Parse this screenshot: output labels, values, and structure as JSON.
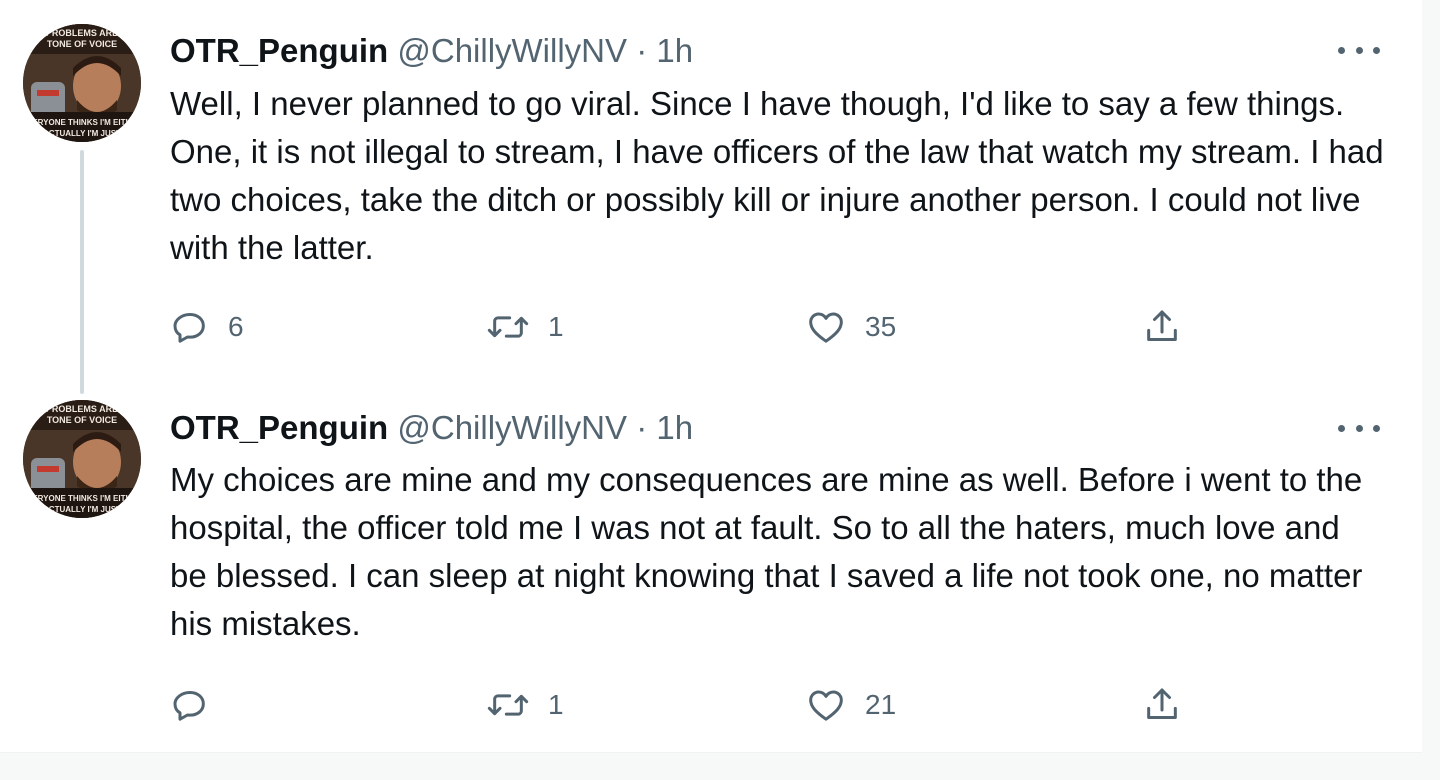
{
  "tweets": [
    {
      "display_name": "OTR_Penguin",
      "handle": "@ChillyWillyNV",
      "separator": "·",
      "time": "1h",
      "avatar_icon": "profile-photo-meme",
      "text": "Well, I never planned to go viral. Since I have though, I'd like to say a few things. One, it is not illegal to stream, I have officers of the law that watch my stream. I had two choices, take the ditch or possibly kill or injure another person. I could not live with the latter.",
      "replies": "6",
      "retweets": "1",
      "likes": "35"
    },
    {
      "display_name": "OTR_Penguin",
      "handle": "@ChillyWillyNV",
      "separator": "·",
      "time": "1h",
      "avatar_icon": "profile-photo-meme",
      "text": "My choices are mine and my consequences are mine as well. Before i went to the hospital, the officer told me I was not at fault. So to all the haters, much love and be blessed. I can sleep at night knowing that I saved a life not took one, no matter his mistakes.",
      "replies": "",
      "retweets": "1",
      "likes": "21"
    }
  ],
  "icons": {
    "reply": "reply-icon",
    "retweet": "retweet-icon",
    "like": "heart-icon",
    "share": "share-icon",
    "more": "more-options-icon"
  },
  "colors": {
    "text": "#0f1419",
    "secondary": "#536471",
    "thread_line": "#cfd9de",
    "background": "#ffffff"
  }
}
